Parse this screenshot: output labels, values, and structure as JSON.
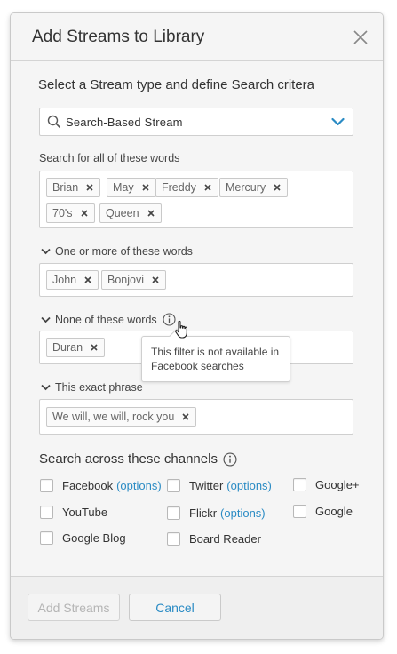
{
  "dialog": {
    "title": "Add Streams to Library",
    "intro": "Select a Stream type and define Search critera"
  },
  "stream_type": {
    "selected": "Search-Based Stream"
  },
  "all_words": {
    "label": "Search for all of these words",
    "tags": [
      "Brian",
      "May",
      "Freddy",
      "Mercury",
      "70's",
      "Queen"
    ]
  },
  "any_words": {
    "label": "One or more of these words",
    "tags": [
      "John",
      "Bonjovi"
    ]
  },
  "none_words": {
    "label": "None of these words",
    "tags": [
      "Duran"
    ],
    "tooltip": "This filter is not available in Facebook searches"
  },
  "exact_phrase": {
    "label": "This exact phrase",
    "tags": [
      "We will, we will, rock you"
    ]
  },
  "channels": {
    "title": "Search across these channels",
    "options_label": "(options)",
    "items": [
      {
        "label": "Facebook",
        "has_options": true,
        "checked": false
      },
      {
        "label": "Twitter",
        "has_options": true,
        "checked": false
      },
      {
        "label": "Google+",
        "has_options": false,
        "checked": false
      },
      {
        "label": "YouTube",
        "has_options": false,
        "checked": false
      },
      {
        "label": "Flickr",
        "has_options": true,
        "checked": false
      },
      {
        "label": "Google",
        "has_options": false,
        "checked": false
      },
      {
        "label": "Google Blog",
        "has_options": false,
        "checked": false
      },
      {
        "label": "Board Reader",
        "has_options": false,
        "checked": false
      }
    ]
  },
  "footer": {
    "add_label": "Add Streams",
    "cancel_label": "Cancel"
  },
  "colors": {
    "accent": "#2a8bc4",
    "disabled_text": "#b5b5b5"
  },
  "icons": {
    "close": "close-icon",
    "search": "search-icon",
    "dropdown": "chevron-down-icon",
    "collapse": "caret-down-icon",
    "remove_tag": "remove-tag-icon",
    "info": "info-icon",
    "pointer": "hand-cursor-icon"
  }
}
